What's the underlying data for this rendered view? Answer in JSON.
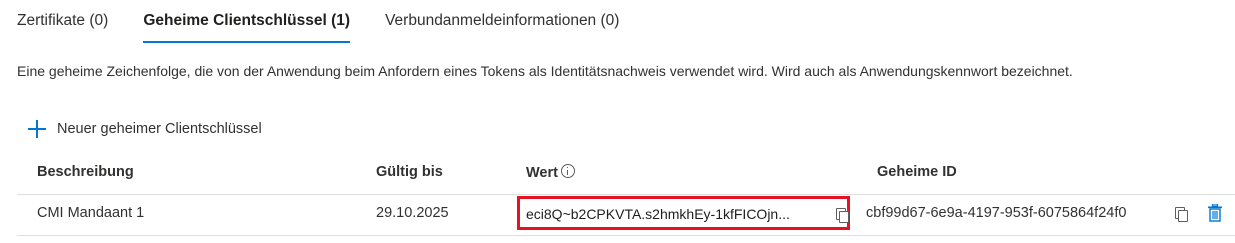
{
  "tabs": [
    {
      "label": "Zertifikate (0)",
      "active": false
    },
    {
      "label": "Geheime Clientschlüssel (1)",
      "active": true
    },
    {
      "label": "Verbundanmeldeinformationen (0)",
      "active": false
    }
  ],
  "description": "Eine geheime Zeichenfolge, die von der Anwendung beim Anfordern eines Tokens als Identitätsnachweis verwendet wird. Wird auch als Anwendungskennwort bezeichnet.",
  "new_secret": {
    "label": "Neuer geheimer Clientschlüssel",
    "icon": "plus-icon"
  },
  "table": {
    "headers": {
      "description": "Beschreibung",
      "expires": "Gültig bis",
      "value": "Wert",
      "secret_id": "Geheime ID"
    },
    "rows": [
      {
        "description": "CMI Mandaant 1",
        "expires": "29.10.2025",
        "value": "eci8Q~b2CPKVTA.s2hmkhEy-1kfFICOjn...",
        "secret_id": "cbf99d67-6e9a-4197-953f-6075864f24f0"
      }
    ]
  },
  "colors": {
    "accent": "#0078d4",
    "highlight": "#e81123",
    "text": "#323130"
  }
}
